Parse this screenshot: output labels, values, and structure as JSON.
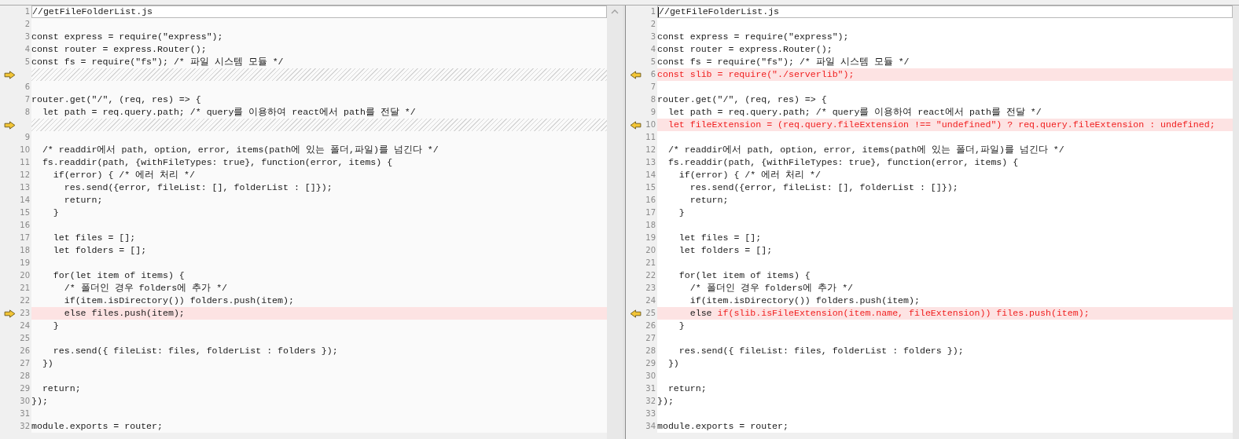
{
  "panes": [
    {
      "rows": [
        {
          "kind": "line",
          "number": "1",
          "text": "//getFileFolderList.js",
          "highlighted": false,
          "current": true,
          "arrow": false
        },
        {
          "kind": "line",
          "number": "2",
          "highlighted": false,
          "current": false,
          "arrow": false
        },
        {
          "kind": "line",
          "number": "3",
          "text": "const express = require(\"express\");",
          "highlighted": false,
          "current": false,
          "arrow": false
        },
        {
          "kind": "line",
          "number": "4",
          "text": "const router = express.Router();",
          "highlighted": false,
          "current": false,
          "arrow": false
        },
        {
          "kind": "line",
          "number": "5",
          "text": "const fs = require(\"fs\"); /* 파일 시스템 모듈 */",
          "highlighted": false,
          "current": false,
          "arrow": false
        },
        {
          "kind": "gap",
          "arrow": true
        },
        {
          "kind": "line",
          "number": "6",
          "highlighted": false,
          "current": false,
          "arrow": false
        },
        {
          "kind": "line",
          "number": "7",
          "text": "router.get(\"/\", (req, res) => {",
          "highlighted": false,
          "current": false,
          "arrow": false
        },
        {
          "kind": "line",
          "number": "8",
          "text": "  let path = req.query.path; /* query를 이용하여 react에서 path를 전달 */",
          "highlighted": false,
          "current": false,
          "arrow": false
        },
        {
          "kind": "gap",
          "arrow": true
        },
        {
          "kind": "line",
          "number": "9",
          "highlighted": false,
          "current": false,
          "arrow": false
        },
        {
          "kind": "line",
          "number": "10",
          "text": "  /* readdir에서 path, option, error, items(path에 있는 폴더,파일)를 넘긴다 */",
          "highlighted": false,
          "current": false,
          "arrow": false
        },
        {
          "kind": "line",
          "number": "11",
          "text": "  fs.readdir(path, {withFileTypes: true}, function(error, items) {",
          "highlighted": false,
          "current": false,
          "arrow": false
        },
        {
          "kind": "line",
          "number": "12",
          "text": "    if(error) { /* 에러 처리 */",
          "highlighted": false,
          "current": false,
          "arrow": false
        },
        {
          "kind": "line",
          "number": "13",
          "text": "      res.send({error, fileList: [], folderList : []});",
          "highlighted": false,
          "current": false,
          "arrow": false
        },
        {
          "kind": "line",
          "number": "14",
          "text": "      return;",
          "highlighted": false,
          "current": false,
          "arrow": false
        },
        {
          "kind": "line",
          "number": "15",
          "text": "    }",
          "highlighted": false,
          "current": false,
          "arrow": false
        },
        {
          "kind": "line",
          "number": "16",
          "highlighted": false,
          "current": false,
          "arrow": false
        },
        {
          "kind": "line",
          "number": "17",
          "text": "    let files = [];",
          "highlighted": false,
          "current": false,
          "arrow": false
        },
        {
          "kind": "line",
          "number": "18",
          "text": "    let folders = [];",
          "highlighted": false,
          "current": false,
          "arrow": false
        },
        {
          "kind": "line",
          "number": "19",
          "highlighted": false,
          "current": false,
          "arrow": false
        },
        {
          "kind": "line",
          "number": "20",
          "text": "    for(let item of items) {",
          "highlighted": false,
          "current": false,
          "arrow": false
        },
        {
          "kind": "line",
          "number": "21",
          "text": "      /* 폴더인 경우 folders에 추가 */",
          "highlighted": false,
          "current": false,
          "arrow": false
        },
        {
          "kind": "line",
          "number": "22",
          "text": "      if(item.isDirectory()) folders.push(item);",
          "highlighted": false,
          "current": false,
          "arrow": false
        },
        {
          "kind": "line",
          "number": "23",
          "text": "      else files.push(item);",
          "highlighted": true,
          "current": false,
          "arrow": true
        },
        {
          "kind": "line",
          "number": "24",
          "text": "    }",
          "highlighted": false,
          "current": false,
          "arrow": false
        },
        {
          "kind": "line",
          "number": "25",
          "highlighted": false,
          "current": false,
          "arrow": false
        },
        {
          "kind": "line",
          "number": "26",
          "text": "    res.send({ fileList: files, folderList : folders });",
          "highlighted": false,
          "current": false,
          "arrow": false
        },
        {
          "kind": "line",
          "number": "27",
          "text": "  })",
          "highlighted": false,
          "current": false,
          "arrow": false
        },
        {
          "kind": "line",
          "number": "28",
          "highlighted": false,
          "current": false,
          "arrow": false
        },
        {
          "kind": "line",
          "number": "29",
          "text": "  return;",
          "highlighted": false,
          "current": false,
          "arrow": false
        },
        {
          "kind": "line",
          "number": "30",
          "text": "});",
          "highlighted": false,
          "current": false,
          "arrow": false
        },
        {
          "kind": "line",
          "number": "31",
          "highlighted": false,
          "current": false,
          "arrow": false
        },
        {
          "kind": "line",
          "number": "32",
          "text": "module.exports = router;",
          "highlighted": false,
          "current": false,
          "arrow": false
        }
      ]
    },
    {
      "rows": [
        {
          "kind": "line",
          "number": "1",
          "text": "//getFileFolderList.js",
          "highlighted": false,
          "current": true,
          "arrow": false
        },
        {
          "kind": "line",
          "number": "2",
          "highlighted": false,
          "current": false,
          "arrow": false
        },
        {
          "kind": "line",
          "number": "3",
          "text": "const express = require(\"express\");",
          "highlighted": false,
          "current": false,
          "arrow": false
        },
        {
          "kind": "line",
          "number": "4",
          "text": "const router = express.Router();",
          "highlighted": false,
          "current": false,
          "arrow": false
        },
        {
          "kind": "line",
          "number": "5",
          "text": "const fs = require(\"fs\"); /* 파일 시스템 모듈 */",
          "highlighted": false,
          "current": false,
          "arrow": false
        },
        {
          "kind": "line",
          "number": "6",
          "changed_text": "const slib = require(\"./serverlib\");",
          "highlighted": true,
          "current": false,
          "arrow": true
        },
        {
          "kind": "line",
          "number": "7",
          "highlighted": false,
          "current": false,
          "arrow": false
        },
        {
          "kind": "line",
          "number": "8",
          "text": "router.get(\"/\", (req, res) => {",
          "highlighted": false,
          "current": false,
          "arrow": false
        },
        {
          "kind": "line",
          "number": "9",
          "text": "  let path = req.query.path; /* query를 이용하여 react에서 path를 전달 */",
          "highlighted": false,
          "current": false,
          "arrow": false
        },
        {
          "kind": "line",
          "number": "10",
          "text": "  ",
          "changed_text": "let fileExtension = (req.query.fileExtension !== \"undefined\") ? req.query.fileExtension : undefined;",
          "highlighted": true,
          "current": false,
          "arrow": true
        },
        {
          "kind": "line",
          "number": "11",
          "highlighted": false,
          "current": false,
          "arrow": false
        },
        {
          "kind": "line",
          "number": "12",
          "text": "  /* readdir에서 path, option, error, items(path에 있는 폴더,파일)를 넘긴다 */",
          "highlighted": false,
          "current": false,
          "arrow": false
        },
        {
          "kind": "line",
          "number": "13",
          "text": "  fs.readdir(path, {withFileTypes: true}, function(error, items) {",
          "highlighted": false,
          "current": false,
          "arrow": false
        },
        {
          "kind": "line",
          "number": "14",
          "text": "    if(error) { /* 에러 처리 */",
          "highlighted": false,
          "current": false,
          "arrow": false
        },
        {
          "kind": "line",
          "number": "15",
          "text": "      res.send({error, fileList: [], folderList : []});",
          "highlighted": false,
          "current": false,
          "arrow": false
        },
        {
          "kind": "line",
          "number": "16",
          "text": "      return;",
          "highlighted": false,
          "current": false,
          "arrow": false
        },
        {
          "kind": "line",
          "number": "17",
          "text": "    }",
          "highlighted": false,
          "current": false,
          "arrow": false
        },
        {
          "kind": "line",
          "number": "18",
          "highlighted": false,
          "current": false,
          "arrow": false
        },
        {
          "kind": "line",
          "number": "19",
          "text": "    let files = [];",
          "highlighted": false,
          "current": false,
          "arrow": false
        },
        {
          "kind": "line",
          "number": "20",
          "text": "    let folders = [];",
          "highlighted": false,
          "current": false,
          "arrow": false
        },
        {
          "kind": "line",
          "number": "21",
          "highlighted": false,
          "current": false,
          "arrow": false
        },
        {
          "kind": "line",
          "number": "22",
          "text": "    for(let item of items) {",
          "highlighted": false,
          "current": false,
          "arrow": false
        },
        {
          "kind": "line",
          "number": "23",
          "text": "      /* 폴더인 경우 folders에 추가 */",
          "highlighted": false,
          "current": false,
          "arrow": false
        },
        {
          "kind": "line",
          "number": "24",
          "text": "      if(item.isDirectory()) folders.push(item);",
          "highlighted": false,
          "current": false,
          "arrow": false
        },
        {
          "kind": "line",
          "number": "25",
          "text": "      else ",
          "changed_text": "if(slib.isFileExtension(item.name, fileExtension)) files.push(item);",
          "highlighted": true,
          "current": false,
          "arrow": true
        },
        {
          "kind": "line",
          "number": "26",
          "text": "    }",
          "highlighted": false,
          "current": false,
          "arrow": false
        },
        {
          "kind": "line",
          "number": "27",
          "highlighted": false,
          "current": false,
          "arrow": false
        },
        {
          "kind": "line",
          "number": "28",
          "text": "    res.send({ fileList: files, folderList : folders });",
          "highlighted": false,
          "current": false,
          "arrow": false
        },
        {
          "kind": "line",
          "number": "29",
          "text": "  })",
          "highlighted": false,
          "current": false,
          "arrow": false
        },
        {
          "kind": "line",
          "number": "30",
          "highlighted": false,
          "current": false,
          "arrow": false
        },
        {
          "kind": "line",
          "number": "31",
          "text": "  return;",
          "highlighted": false,
          "current": false,
          "arrow": false
        },
        {
          "kind": "line",
          "number": "32",
          "text": "});",
          "highlighted": false,
          "current": false,
          "arrow": false
        },
        {
          "kind": "line",
          "number": "33",
          "highlighted": false,
          "current": false,
          "arrow": false
        },
        {
          "kind": "line",
          "number": "34",
          "text": "module.exports = router;",
          "highlighted": false,
          "current": false,
          "arrow": false
        }
      ]
    }
  ]
}
